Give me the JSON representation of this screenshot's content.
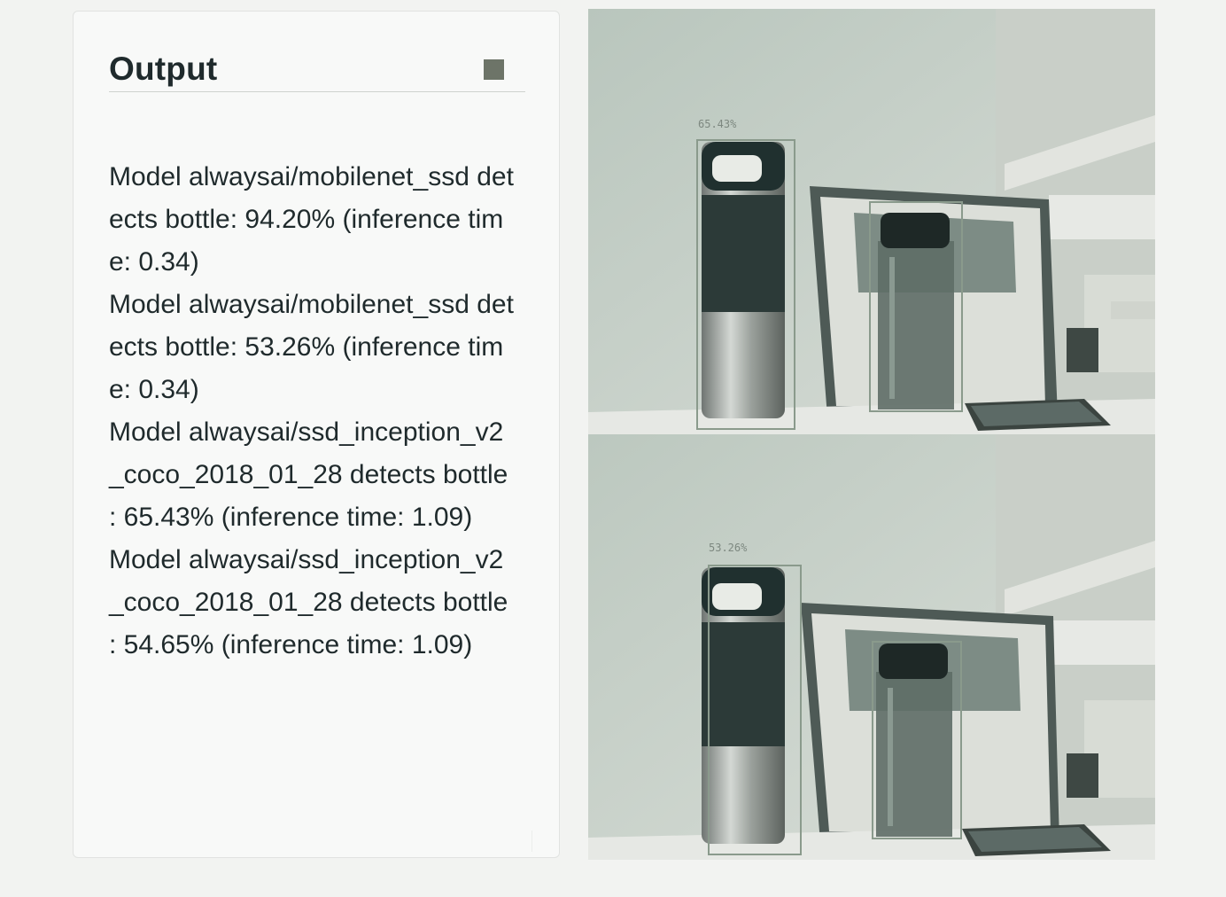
{
  "output_panel": {
    "title": "Output",
    "stop_icon": "stop-square-icon",
    "lines": [
      "Model alwaysai/mobilenet_ssd detects bottle: 94.20% (inference time: 0.34)",
      "Model alwaysai/mobilenet_ssd detects bottle: 53.26% (inference time: 0.34)",
      "Model alwaysai/ssd_inception_v2_coco_2018_01_28 detects bottle : 65.43% (inference time: 1.09)",
      "Model alwaysai/ssd_inception_v2_coco_2018_01_28 detects bottle : 54.65% (inference time: 1.09)"
    ]
  },
  "camera_frames": [
    {
      "detection_label": "65.43%"
    },
    {
      "detection_label": "53.26%"
    }
  ],
  "colors": {
    "panel_bg": "#f8f9f8",
    "title_text": "#1f2a2c",
    "stop_icon": "#6d7468",
    "bbox": "#8a9a8c"
  }
}
